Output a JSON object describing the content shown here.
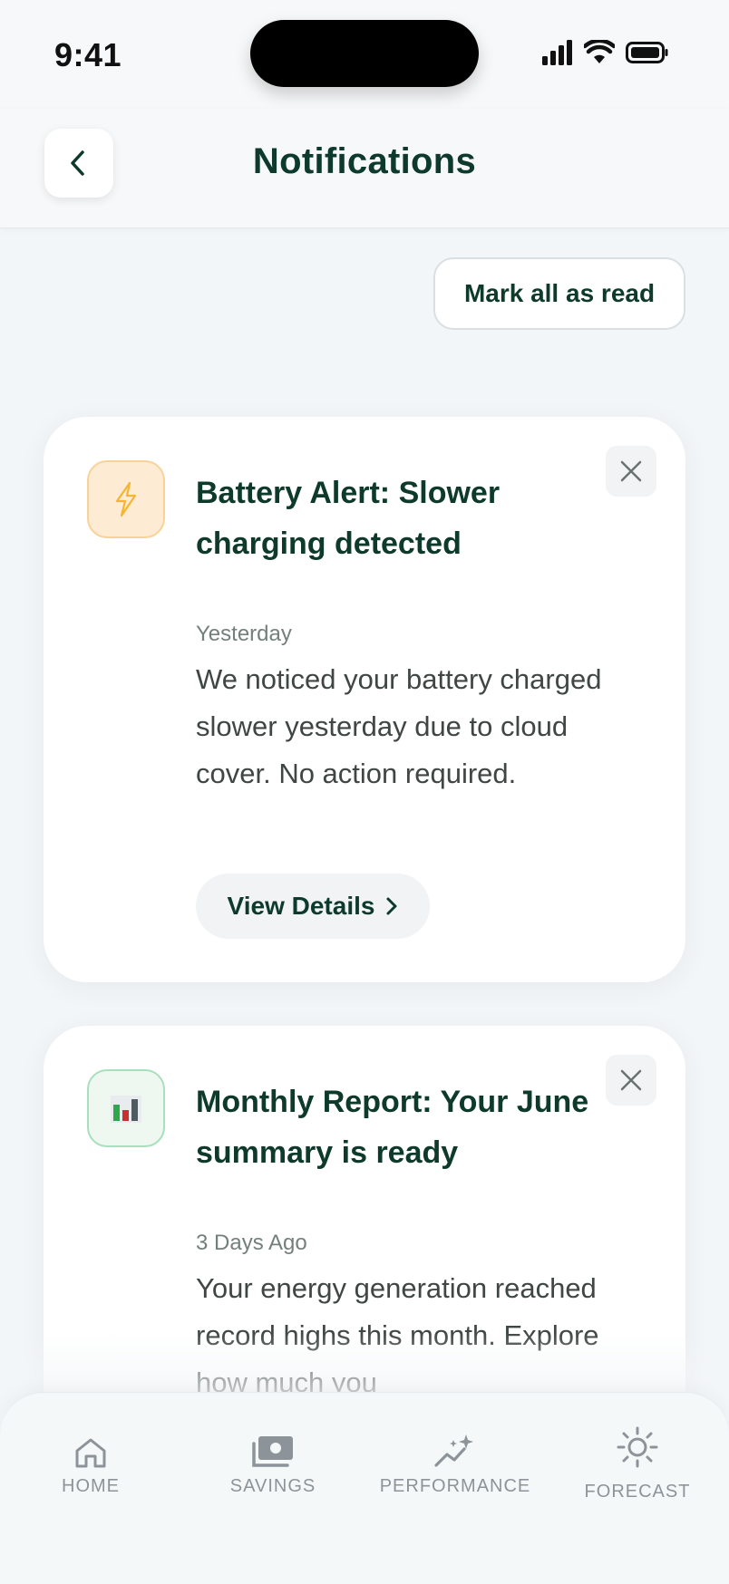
{
  "status_bar": {
    "time": "9:41"
  },
  "header": {
    "title": "Notifications",
    "back_icon": "chevron-left-icon"
  },
  "actions": {
    "mark_all_read": "Mark all as read"
  },
  "notifications": [
    {
      "icon": "lightning-bolt-icon",
      "title": "Battery Alert: Slower charging detected",
      "time": "Yesterday",
      "body": "We noticed your battery charged slower yesterday due to cloud cover. No action required.",
      "button": "View Details"
    },
    {
      "icon": "bar-chart-icon",
      "title": "Monthly Report: Your June summary is ready",
      "time": "3 Days Ago",
      "body": "Your energy generation reached record highs this month. Explore how much you"
    }
  ],
  "tabs": [
    {
      "label": "HOME",
      "icon": "home-icon"
    },
    {
      "label": "SAVINGS",
      "icon": "cash-icon"
    },
    {
      "label": "PERFORMANCE",
      "icon": "sparkle-trend-icon"
    },
    {
      "label": "FORECAST",
      "icon": "sun-icon"
    }
  ],
  "colors": {
    "primary_text": "#0e3a2c",
    "background": "#f3f6f8",
    "bolt_accent": "#f5b532",
    "chart_green": "#2ea84a",
    "chart_red": "#c8312f",
    "tab_inactive": "#8c9499"
  }
}
